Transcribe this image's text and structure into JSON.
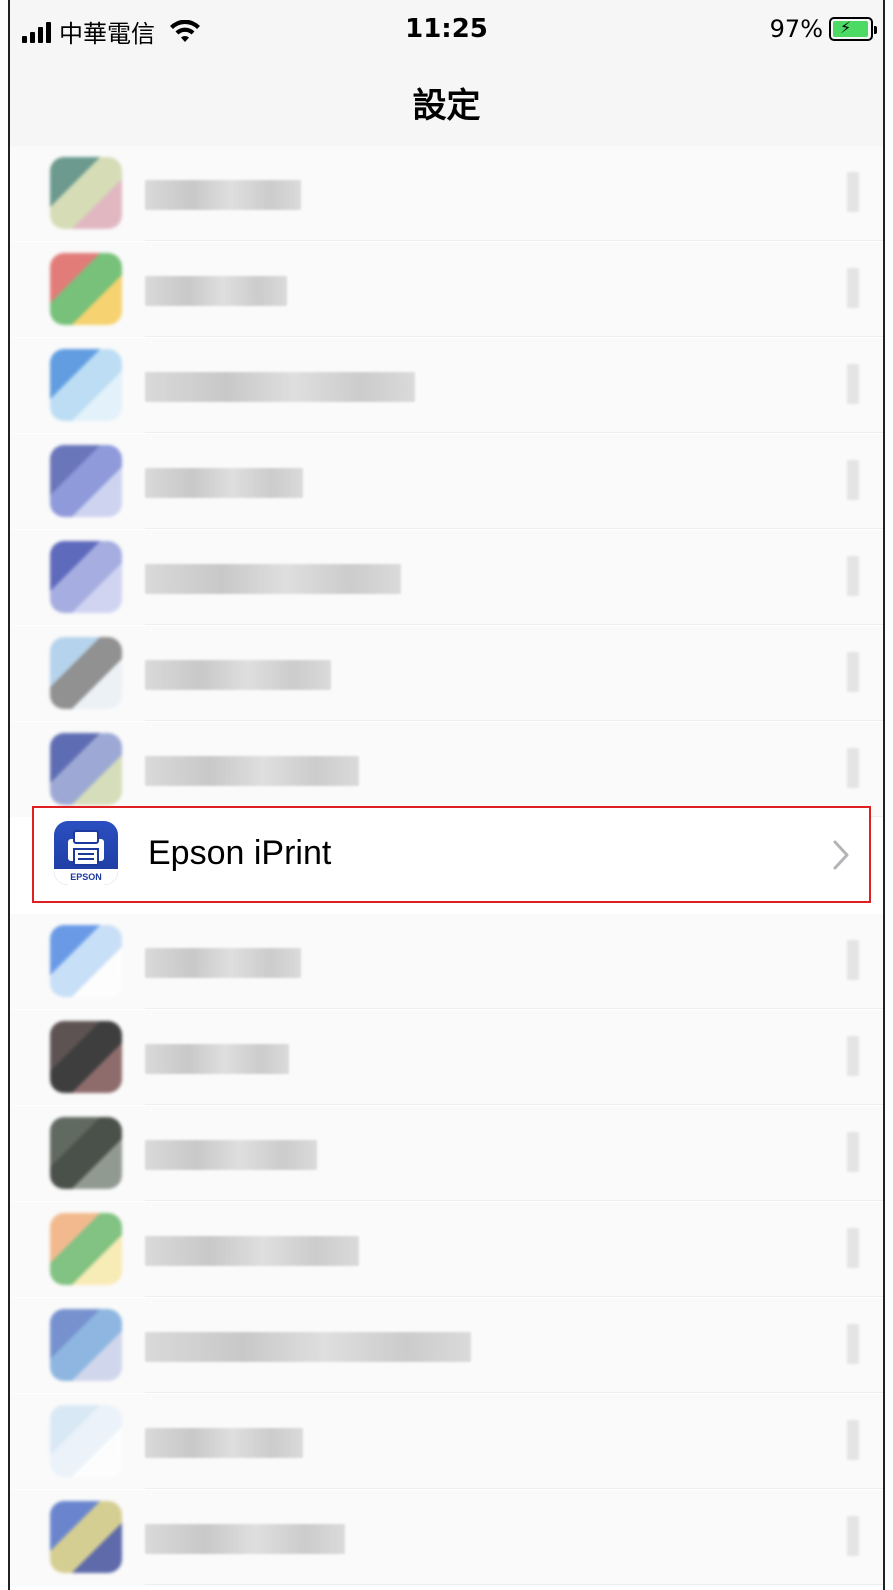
{
  "status_bar": {
    "carrier": "中華電信",
    "time": "11:25",
    "battery_percent": "97%",
    "battery_level": 0.97,
    "signal_bars": 4
  },
  "nav": {
    "title": "設定"
  },
  "apps": [
    {
      "name": "blurred-app-1",
      "blurred": true,
      "colors": [
        "#3d7a6a",
        "#c9d3a0",
        "#d9a3b0"
      ]
    },
    {
      "name": "blurred-app-2",
      "blurred": true,
      "colors": [
        "#d9534f",
        "#4caf50",
        "#f5c542"
      ]
    },
    {
      "name": "blurred-app-3",
      "blurred": true,
      "colors": [
        "#2f7fd8",
        "#a9d4f2",
        "#dbeefb"
      ]
    },
    {
      "name": "blurred-app-4",
      "blurred": true,
      "colors": [
        "#3a4aa5",
        "#6b7bd0",
        "#c0c6ec"
      ]
    },
    {
      "name": "blurred-app-5",
      "blurred": true,
      "colors": [
        "#2a3aa8",
        "#8a94d8",
        "#c3c8ef"
      ]
    },
    {
      "name": "blurred-app-6",
      "blurred": true,
      "colors": [
        "#9fc6e8",
        "#6e6e6e",
        "#e8eef5"
      ]
    },
    {
      "name": "blurred-app-7",
      "blurred": true,
      "colors": [
        "#2b3f9c",
        "#7f8fc8",
        "#c9d4a5"
      ]
    },
    {
      "name": "Epson iPrint",
      "blurred": false,
      "brand_text": "EPSON",
      "highlighted": true
    },
    {
      "name": "blurred-app-9",
      "blurred": true,
      "colors": [
        "#3a7be0",
        "#b7d6f6",
        "#ffffff"
      ]
    },
    {
      "name": "blurred-app-10",
      "blurred": true,
      "colors": [
        "#2a1c1c",
        "#000000",
        "#6b3d3d"
      ]
    },
    {
      "name": "blurred-app-11",
      "blurred": true,
      "colors": [
        "#2e3a2e",
        "#101810",
        "#6f7a6f"
      ]
    },
    {
      "name": "blurred-app-12",
      "blurred": true,
      "colors": [
        "#f0a46a",
        "#5ab05a",
        "#f7e6a0"
      ]
    },
    {
      "name": "blurred-app-13",
      "blurred": true,
      "colors": [
        "#4a6fc0",
        "#6aa0d8",
        "#c3cbe8"
      ]
    },
    {
      "name": "blurred-app-14",
      "blurred": true,
      "colors": [
        "#cfe3f4",
        "#e6f0f9",
        "#ffffff"
      ]
    },
    {
      "name": "blurred-app-15",
      "blurred": true,
      "colors": [
        "#3b5fc0",
        "#c9c070",
        "#2a3a90"
      ]
    }
  ]
}
